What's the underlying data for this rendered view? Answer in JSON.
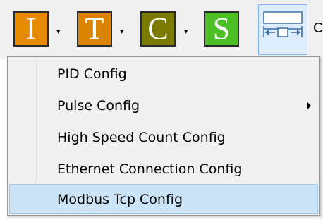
{
  "toolbar": {
    "buttons": [
      {
        "letter": "I",
        "color": "#e68a00"
      },
      {
        "letter": "T",
        "color": "#d98300"
      },
      {
        "letter": "C",
        "color": "#7a7a00"
      },
      {
        "letter": "S",
        "color": "#4dbf26"
      }
    ],
    "dropdown_arrow": "▾",
    "layout_button_icon": "layout-arrows-icon",
    "cutoff_text": "C"
  },
  "menu": {
    "items": [
      {
        "label": "PID Config",
        "has_submenu": false
      },
      {
        "label": "Pulse Config",
        "has_submenu": true
      },
      {
        "label": "High Speed Count Config",
        "has_submenu": false
      },
      {
        "label": "Ethernet Connection Config",
        "has_submenu": false
      },
      {
        "label": "Modbus Tcp Config",
        "has_submenu": false,
        "highlighted": true
      }
    ],
    "highlight_color": "#cce4f7"
  }
}
